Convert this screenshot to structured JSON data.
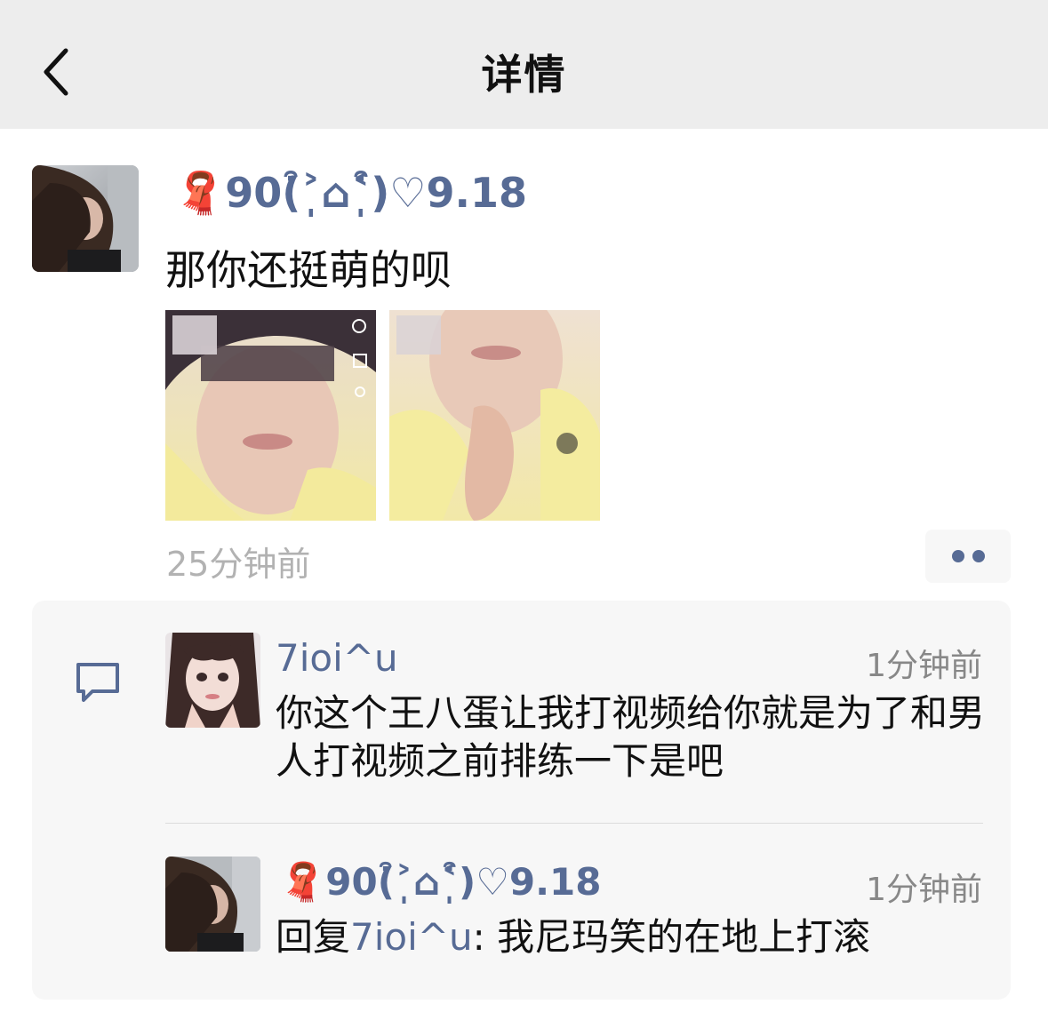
{
  "nav": {
    "title": "详情",
    "back_icon": "chevron-left-icon"
  },
  "post": {
    "author": "90(͒˃̩̩⌂˂̩̩͒)♡9.18",
    "author_badge": "🧣",
    "text": "那你还挺萌的呗",
    "time": "25分钟前",
    "photos": [
      "photo-1",
      "photo-2"
    ]
  },
  "comments": [
    {
      "author": "7ioi^u",
      "time": "1分钟前",
      "text": "你这个王八蛋让我打视频给你就是为了和男人打视频之前排练一下是吧"
    },
    {
      "author": "90(͒˃̩̩⌂˂̩̩͒)♡9.18",
      "author_badge": "🧣",
      "time": "1分钟前",
      "reply_prefix": "回复",
      "reply_to": "7ioi^u",
      "reply_sep": ": ",
      "text": "我尼玛笑的在地上打滚"
    }
  ],
  "colors": {
    "link": "#576b95",
    "nav_bg": "#ededed",
    "comment_bg": "#f7f7f7"
  }
}
